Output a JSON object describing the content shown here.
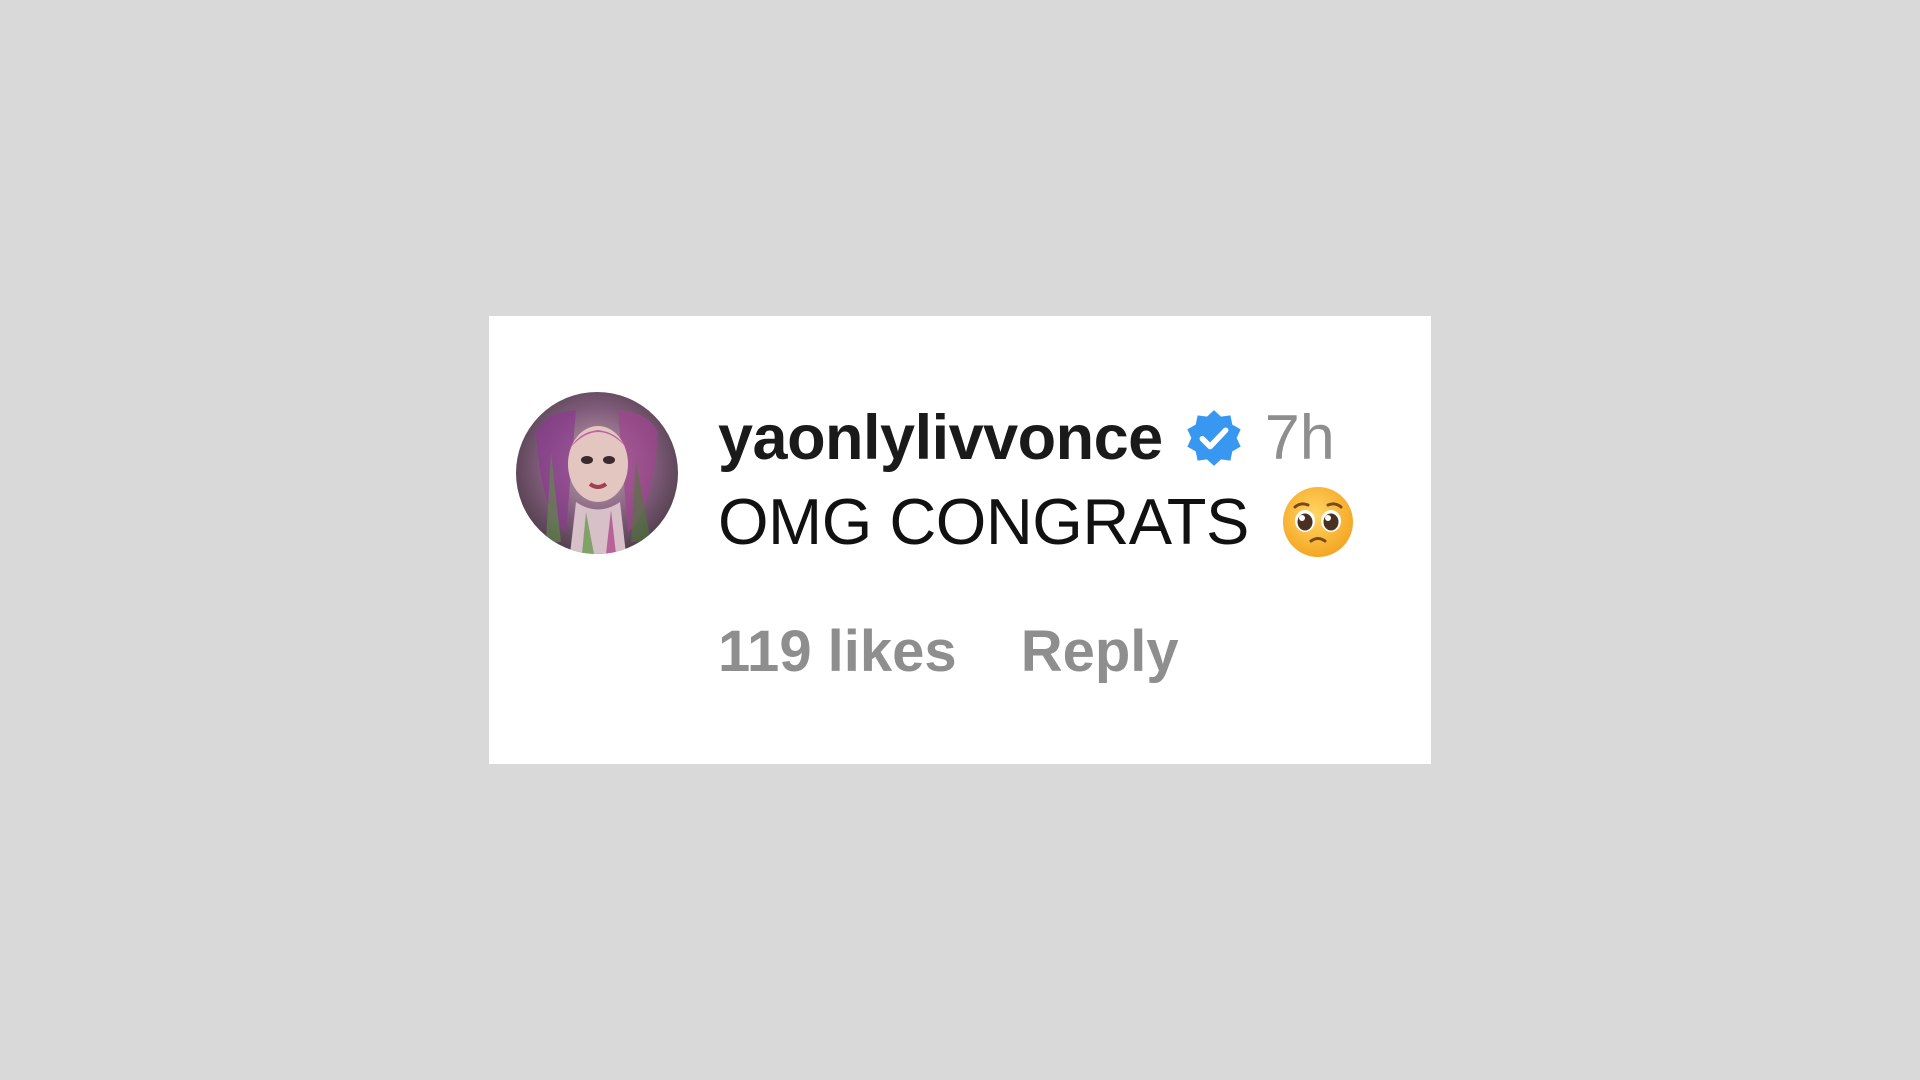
{
  "comment": {
    "avatar_alt": "profile picture",
    "username": "yaonlylivvonce",
    "verified_icon": "verified-badge-icon",
    "timestamp": "7h",
    "text": "OMG CONGRATS",
    "emoji_icon": "pleading-face-emoji",
    "likes_label": "119 likes",
    "reply_label": "Reply"
  },
  "colors": {
    "page_background": "#d9d9d9",
    "card_background": "#ffffff",
    "username": "#1a1a1a",
    "muted_text": "#8e8e8e",
    "verified_blue": "#3897f0"
  }
}
